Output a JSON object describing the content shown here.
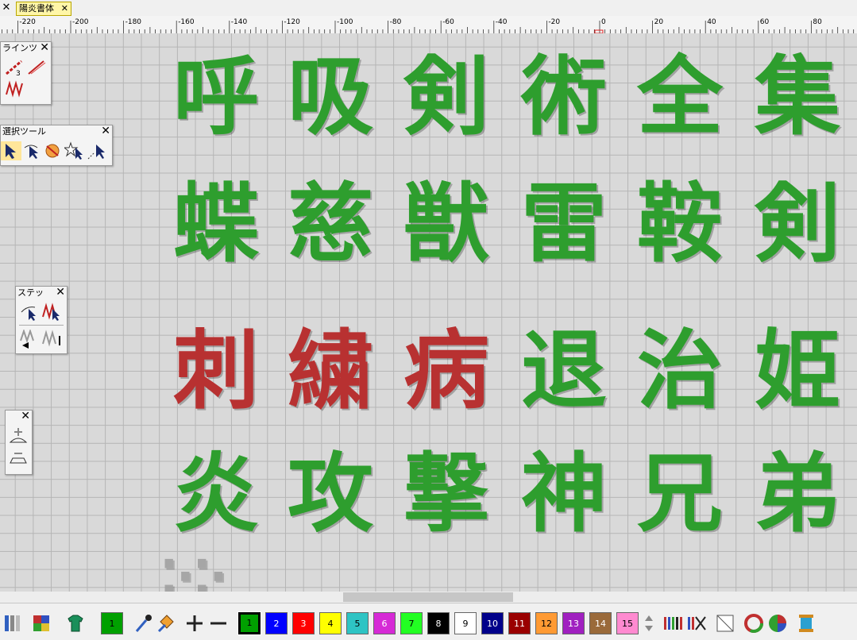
{
  "tab": {
    "title": "陽炎書体",
    "close": "✕"
  },
  "ruler": {
    "labels": [
      "-220",
      "-200",
      "-180",
      "-160",
      "-140",
      "-120",
      "-100",
      "-80",
      "-60",
      "-40",
      "-20",
      "0",
      "20",
      "40",
      "60",
      "80"
    ]
  },
  "rows": [
    {
      "chars": [
        "呼",
        "吸",
        "剣",
        "術",
        "全",
        "集"
      ],
      "color": "#2e9e2e"
    },
    {
      "chars": [
        "蝶",
        "慈",
        "獣",
        "雷",
        "鞍",
        "剣"
      ],
      "color": "#2e9e2e"
    },
    {
      "chars": [
        "刺",
        "繍",
        "病",
        "退",
        "治",
        "姫"
      ],
      "colors": [
        "#b83131",
        "#b83131",
        "#b83131",
        "#2e9e2e",
        "#2e9e2e",
        "#2e9e2e"
      ]
    },
    {
      "chars": [
        "炎",
        "攻",
        "撃",
        "神",
        "兄",
        "弟"
      ],
      "color": "#2e9e2e"
    }
  ],
  "palettes": {
    "line": {
      "title": "ラインツ",
      "close": "✕"
    },
    "select": {
      "title": "選択ツール",
      "close": "✕"
    },
    "stitch": {
      "title": "ステッ",
      "close": "✕"
    },
    "zoom": {
      "close": "✕"
    }
  },
  "current_color": "1",
  "swatches": [
    {
      "n": "1",
      "c": "#00a000",
      "text": "#000"
    },
    {
      "n": "2",
      "c": "#0000ff",
      "text": "#fff"
    },
    {
      "n": "3",
      "c": "#ff0000",
      "text": "#fff"
    },
    {
      "n": "4",
      "c": "#ffff00",
      "text": "#000"
    },
    {
      "n": "5",
      "c": "#2ec4c4",
      "text": "#000"
    },
    {
      "n": "6",
      "c": "#d62ad6",
      "text": "#fff"
    },
    {
      "n": "7",
      "c": "#22ff22",
      "text": "#000"
    },
    {
      "n": "8",
      "c": "#000000",
      "text": "#fff"
    },
    {
      "n": "9",
      "c": "#ffffff",
      "text": "#000"
    },
    {
      "n": "10",
      "c": "#00008a",
      "text": "#fff"
    },
    {
      "n": "11",
      "c": "#9a0000",
      "text": "#fff"
    },
    {
      "n": "12",
      "c": "#ff9a33",
      "text": "#000"
    },
    {
      "n": "13",
      "c": "#a020c0",
      "text": "#fff"
    },
    {
      "n": "14",
      "c": "#9a6a3a",
      "text": "#fff"
    },
    {
      "n": "15",
      "c": "#ff8ad0",
      "text": "#000"
    }
  ]
}
